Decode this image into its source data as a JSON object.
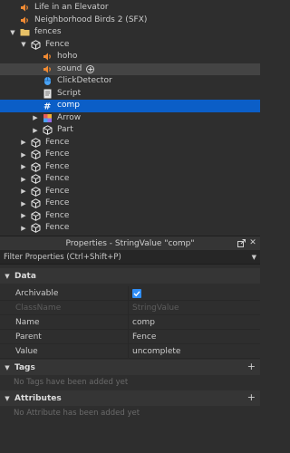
{
  "explorer": {
    "items": [
      {
        "label": "Life in an Elevator",
        "icon": "sound-icon",
        "depth": 1,
        "arrow": ""
      },
      {
        "label": "Neighborhood Birds 2 (SFX)",
        "icon": "sound-icon",
        "depth": 1,
        "arrow": ""
      },
      {
        "label": "fences",
        "icon": "folder-icon",
        "depth": 1,
        "arrow": "expanded"
      },
      {
        "label": "Fence",
        "icon": "model-icon",
        "depth": 2,
        "arrow": "expanded"
      },
      {
        "label": "hoho",
        "icon": "sound-icon",
        "depth": 3,
        "arrow": ""
      },
      {
        "label": "sound",
        "icon": "sound-icon",
        "depth": 3,
        "arrow": "",
        "state": "hovered"
      },
      {
        "label": "ClickDetector",
        "icon": "click-detector-icon",
        "depth": 3,
        "arrow": ""
      },
      {
        "label": "Script",
        "icon": "script-icon",
        "depth": 3,
        "arrow": ""
      },
      {
        "label": "comp",
        "icon": "string-value-icon",
        "depth": 3,
        "arrow": "",
        "state": "selected"
      },
      {
        "label": "Arrow",
        "icon": "union-icon",
        "depth": 3,
        "arrow": "collapsed"
      },
      {
        "label": "Part",
        "icon": "model-icon",
        "depth": 3,
        "arrow": "collapsed"
      },
      {
        "label": "Fence",
        "icon": "model-icon",
        "depth": 2,
        "arrow": "collapsed"
      },
      {
        "label": "Fence",
        "icon": "model-icon",
        "depth": 2,
        "arrow": "collapsed"
      },
      {
        "label": "Fence",
        "icon": "model-icon",
        "depth": 2,
        "arrow": "collapsed"
      },
      {
        "label": "Fence",
        "icon": "model-icon",
        "depth": 2,
        "arrow": "collapsed"
      },
      {
        "label": "Fence",
        "icon": "model-icon",
        "depth": 2,
        "arrow": "collapsed"
      },
      {
        "label": "Fence",
        "icon": "model-icon",
        "depth": 2,
        "arrow": "collapsed"
      },
      {
        "label": "Fence",
        "icon": "model-icon",
        "depth": 2,
        "arrow": "collapsed"
      },
      {
        "label": "Fence",
        "icon": "model-icon",
        "depth": 2,
        "arrow": "collapsed"
      }
    ]
  },
  "properties": {
    "title": "Properties - StringValue \"comp\"",
    "filter_placeholder": "Filter Properties (Ctrl+Shift+P)",
    "sections": {
      "data": {
        "title": "Data",
        "rows": [
          {
            "name": "Archivable",
            "value": "",
            "checked": true,
            "disabled": false
          },
          {
            "name": "ClassName",
            "value": "StringValue",
            "disabled": true
          },
          {
            "name": "Name",
            "value": "comp",
            "disabled": false
          },
          {
            "name": "Parent",
            "value": "Fence",
            "disabled": false
          },
          {
            "name": "Value",
            "value": "uncomplete",
            "disabled": false
          }
        ]
      },
      "tags": {
        "title": "Tags",
        "empty": "No Tags have been added yet"
      },
      "attributes": {
        "title": "Attributes",
        "empty": "No Attribute has been added yet"
      }
    }
  },
  "colors": {
    "selection": "#0b5ec7",
    "sound": "#f08a33",
    "folder": "#e8c167",
    "checkbox": "#2f8df6"
  }
}
